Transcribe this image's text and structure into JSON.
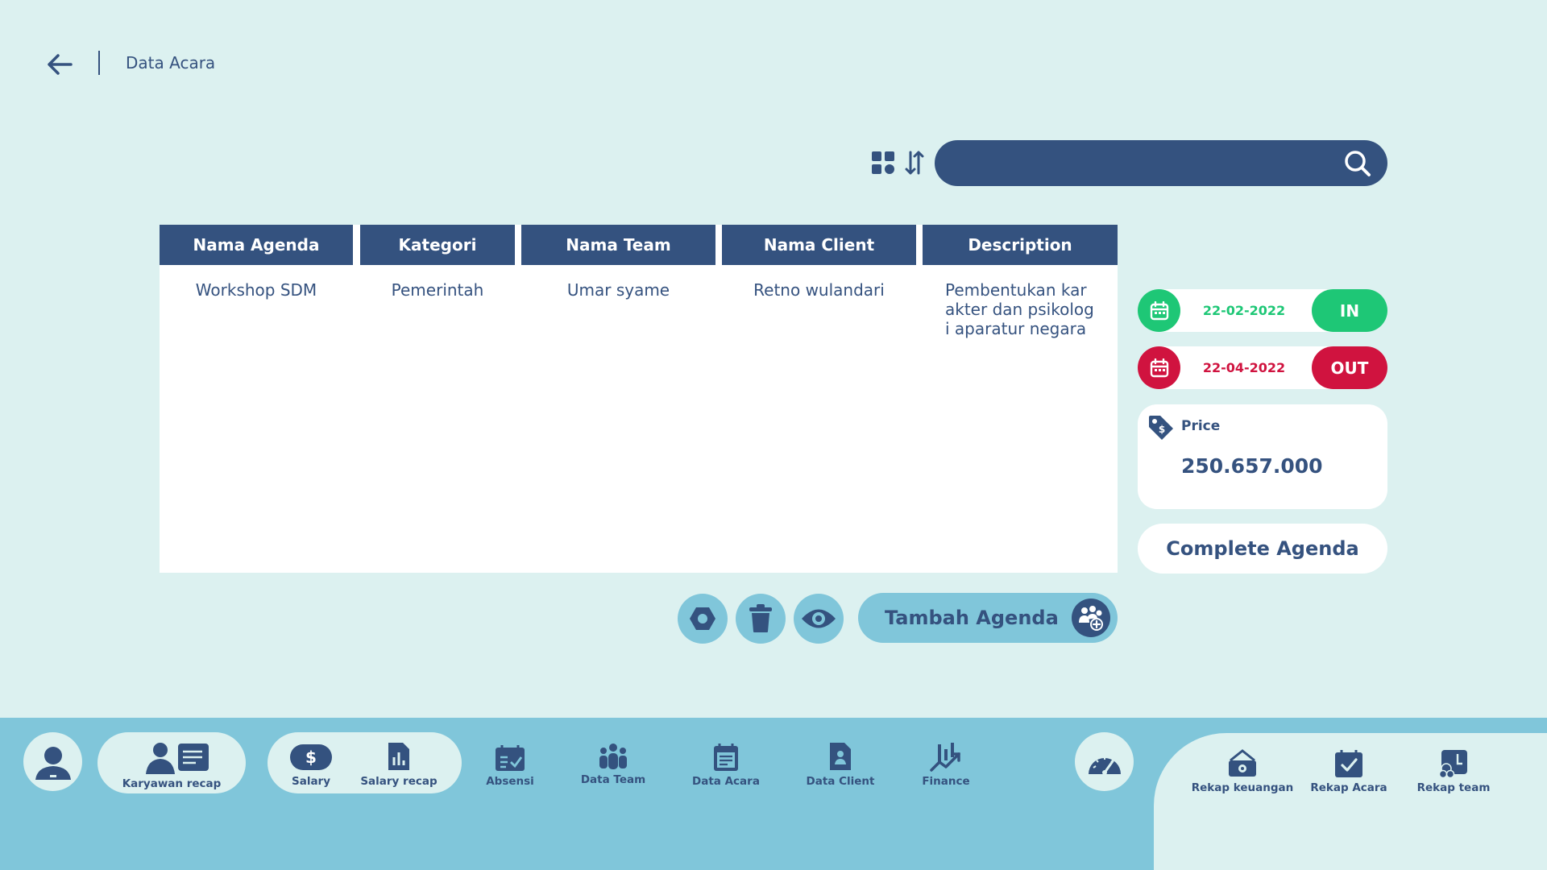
{
  "header": {
    "title": "Data Acara"
  },
  "search": {
    "placeholder": "",
    "value": ""
  },
  "table": {
    "columns": [
      "Nama Agenda",
      "Kategori",
      "Nama Team",
      "Nama Client",
      "Description"
    ],
    "rows": [
      {
        "nama_agenda": "Workshop SDM",
        "kategori": "Pemerintah",
        "nama_team": "Umar syame",
        "nama_client": "Retno wulandari",
        "description_lines": [
          "Pembentukan kar",
          "akter dan psikolog",
          "i aparatur negara"
        ]
      }
    ]
  },
  "dates": {
    "in": {
      "date": "22-02-2022",
      "label": "IN",
      "color": "#1ec776"
    },
    "out": {
      "date": "22-04-2022",
      "label": "OUT",
      "color": "#d0133f"
    }
  },
  "price": {
    "label": "Price",
    "value": "250.657.000"
  },
  "complete_button": "Complete Agenda",
  "actions": {
    "tambah_label": "Tambah Agenda"
  },
  "bottom_nav": {
    "karyawan_recap": "Karyawan recap",
    "salary": "Salary",
    "salary_recap": "Salary recap",
    "absensi": "Absensi",
    "data_team": "Data Team",
    "data_acara": "Data Acara",
    "data_client": "Data Client",
    "finance": "Finance",
    "rekap_keuangan": "Rekap keuangan",
    "rekap_acara": "Rekap Acara",
    "rekap_team": "Rekap team"
  },
  "colors": {
    "background": "#dcf1f0",
    "primary": "#34527f",
    "accent_light": "#80c6da",
    "in_green": "#1ec776",
    "out_red": "#d0133f"
  },
  "icons": [
    "back-arrow-icon",
    "grid-icon",
    "sort-icon",
    "search-icon",
    "calendar-icon",
    "price-tag-icon",
    "settings-icon",
    "trash-icon",
    "eye-icon",
    "add-team-icon",
    "user-icon",
    "speedometer-icon"
  ]
}
